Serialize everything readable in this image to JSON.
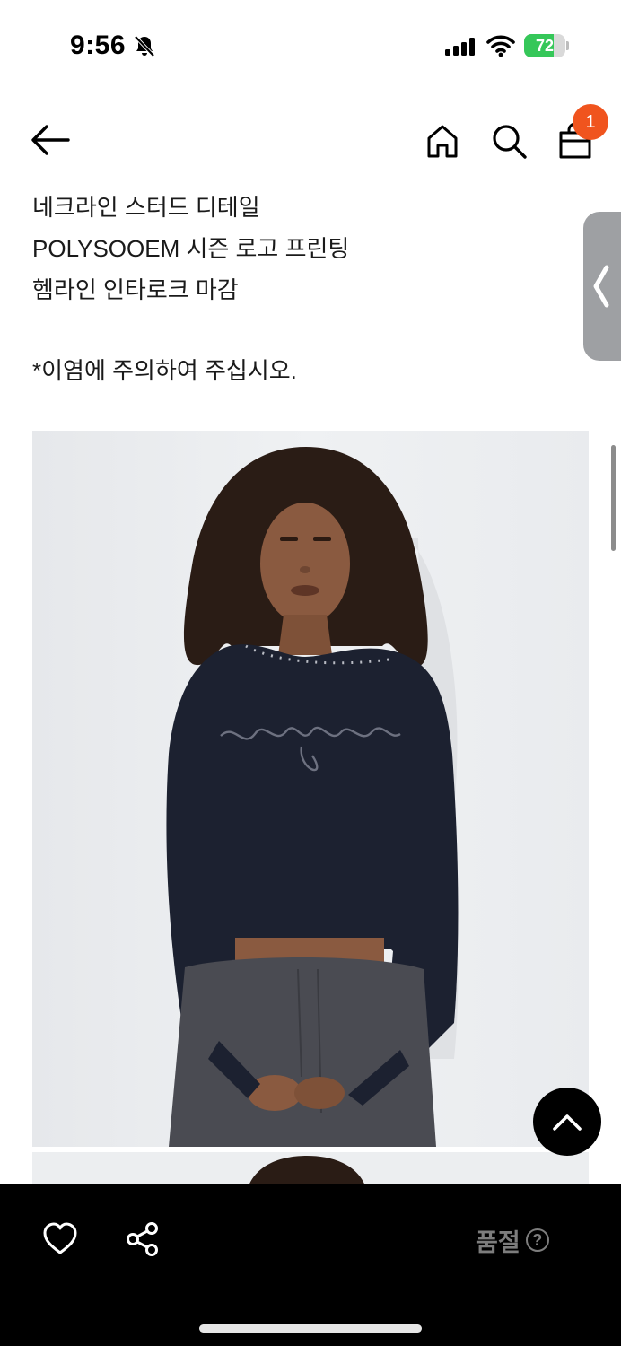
{
  "status_bar": {
    "time": "9:56",
    "battery_percent": "72",
    "battery_level": 0.72,
    "icons": [
      "bell-slash-icon",
      "signal-icon",
      "wifi-icon",
      "battery-charging-icon"
    ]
  },
  "header": {
    "icons": [
      "back-arrow-icon",
      "home-icon",
      "search-icon",
      "shopping-bag-icon"
    ],
    "cart_count": "1"
  },
  "description": {
    "lines": [
      "네크라인 스터드 디테일",
      "POLYSOOEM 시즌 로고 프린팅",
      "헴라인 인타로크 마감"
    ],
    "notice": "*이염에 주의하여 주십시오."
  },
  "bottom_bar": {
    "icons": [
      "heart-icon",
      "share-icon",
      "help-circle-icon"
    ],
    "status_label": "품절",
    "help_symbol": "?"
  },
  "colors": {
    "badge": "#f0541e",
    "battery": "#35c759",
    "bottom_bar": "#000000",
    "soldout_text": "#7d7d7d"
  }
}
